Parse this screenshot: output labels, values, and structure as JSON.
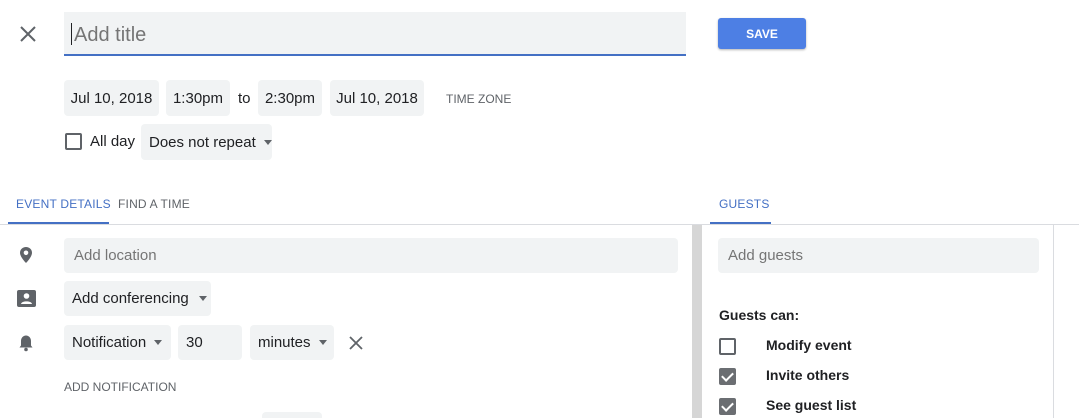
{
  "header": {
    "title_placeholder": "Add title",
    "save_label": "SAVE"
  },
  "datetime": {
    "start_date": "Jul 10, 2018",
    "start_time": "1:30pm",
    "to_label": "to",
    "end_time": "2:30pm",
    "end_date": "Jul 10, 2018",
    "time_zone_label": "TIME ZONE"
  },
  "options": {
    "all_day_label": "All day",
    "all_day_checked": false,
    "repeat_value": "Does not repeat"
  },
  "tabs": {
    "event_details": "EVENT DETAILS",
    "find_a_time": "FIND A TIME",
    "guests": "GUESTS"
  },
  "details": {
    "location_placeholder": "Add location",
    "conferencing_value": "Add conferencing",
    "notification_type": "Notification",
    "notification_amount": "30",
    "notification_unit": "minutes",
    "add_notification_label": "ADD NOTIFICATION"
  },
  "guests": {
    "add_guests_placeholder": "Add guests",
    "guests_can_label": "Guests can:",
    "permissions": [
      {
        "label": "Modify event",
        "checked": false
      },
      {
        "label": "Invite others",
        "checked": true
      },
      {
        "label": "See guest list",
        "checked": true
      }
    ]
  },
  "colors": {
    "accent": "#4470c4",
    "save_button": "#4d7fe4",
    "field_bg": "#f1f3f4"
  },
  "icons": {
    "close": "close-icon",
    "location": "location-pin-icon",
    "conferencing": "conferencing-icon",
    "notification": "bell-icon",
    "remove_notification": "close-icon"
  }
}
